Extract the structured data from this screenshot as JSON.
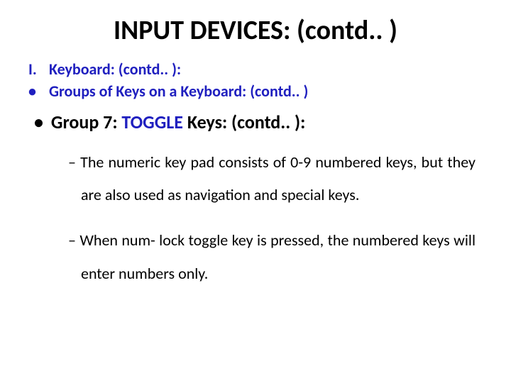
{
  "title": "INPUT DEVICES: (contd.. )",
  "roman_num": "I.",
  "line1": "Keyboard: (contd.. ):",
  "line2_bullet": "•",
  "line2": "Groups of Keys on a Keyboard: (contd.. )",
  "group7": {
    "bullet": "•",
    "prefix": "Group 7:",
    "toggle": "TOGGLE",
    "suffix": "Keys:  (contd.. ):"
  },
  "sub1": "– The numeric key pad consists of 0-9 numbered keys, but they are also used as navigation and special keys.",
  "sub2": "– When num- lock toggle key is pressed, the numbered keys will enter numbers only."
}
